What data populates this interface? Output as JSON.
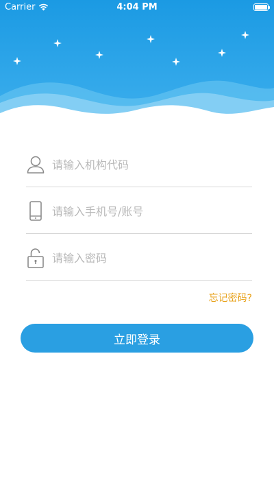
{
  "status_bar": {
    "carrier": "Carrier",
    "time": "4:04 PM"
  },
  "login": {
    "org_code_placeholder": "请输入机构代码",
    "account_placeholder": "请输入手机号/账号",
    "password_placeholder": "请输入密码",
    "forgot_password": "忘记密码?",
    "submit_label": "立即登录"
  },
  "theme": {
    "header_blue": "#1b9ae3",
    "button_blue": "#2a9fe2",
    "forgot_color": "#e8a21b"
  }
}
